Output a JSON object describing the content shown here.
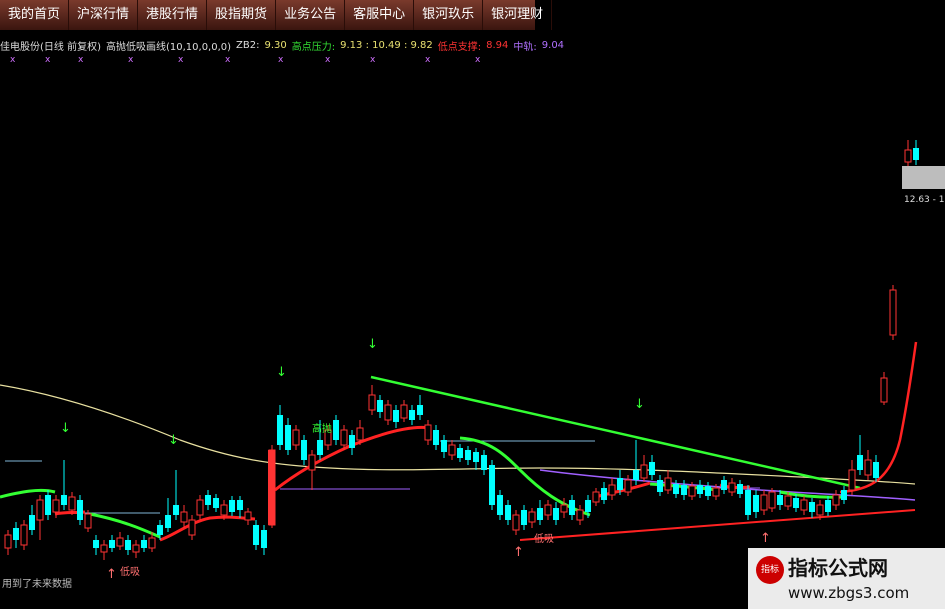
{
  "menu": [
    {
      "label": "我的首页"
    },
    {
      "label": "沪深行情"
    },
    {
      "label": "港股行情"
    },
    {
      "label": "股指期货"
    },
    {
      "label": "业务公告"
    },
    {
      "label": "客服中心"
    },
    {
      "label": "银河玖乐"
    },
    {
      "label": "银河理财"
    }
  ],
  "info": {
    "stock": "佳电股份(日线 前复权)",
    "indicator": "高抛低吸画线(10,10,0,0,0)",
    "zb2_label": "ZB2:",
    "zb2_value": "9.30",
    "high_label": "高点压力:",
    "high_values": "9.13 : 10.49 : 9.82",
    "low_label": "低点支撑:",
    "low_value": "8.94",
    "mid_label": "中轨:",
    "mid_value": "9.04"
  },
  "right_scale": {
    "text": "12.63 - 1"
  },
  "labels": {
    "high_point": "高抛",
    "low_point_1": "低吸",
    "low_point_2": "低吸"
  },
  "bottom_note": "用到了未来数据",
  "watermark": {
    "title": "指标公式网",
    "url": "www.zbgs3.com",
    "logo": "指标"
  },
  "colors": {
    "up": "#ff3333",
    "down": "#00ffff",
    "support": "#ff2222",
    "resistance": "#33ff33",
    "ma": "#e8e0a0",
    "mid": "#b070ff"
  }
}
